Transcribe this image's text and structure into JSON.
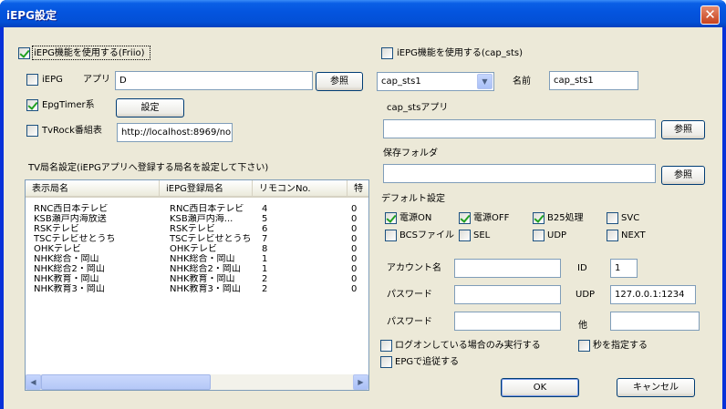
{
  "window": {
    "title": "iEPG設定",
    "close_glyph": "✕"
  },
  "left": {
    "use_friio": {
      "label": "iEPG機能を使用する(Friio)",
      "checked": true
    },
    "iepg": {
      "label": "iEPG",
      "checked": false
    },
    "app_label": "アプリ",
    "app_value": "D",
    "browse_button": "参照",
    "epgtimer": {
      "label": "EpgTimer系",
      "checked": true
    },
    "settings_button": "設定",
    "tvrock": {
      "label": "TvRock番組表",
      "checked": false
    },
    "tvrock_url": "http://localhost:8969/nol",
    "station_list_title": "TV局名設定(iEPGアプリへ登録する局名を設定して下さい)"
  },
  "station_table": {
    "columns": [
      "表示局名",
      "iEPG登録局名",
      "リモコンNo.",
      "特"
    ],
    "rows": [
      [
        "RNC西日本テレビ",
        "RNC西日本テレビ",
        "4",
        "0"
      ],
      [
        "KSB瀬戸内海放送",
        "KSB瀬戸内海...",
        "5",
        "0"
      ],
      [
        "RSKテレビ",
        "RSKテレビ",
        "6",
        "0"
      ],
      [
        "TSCテレビせとうち",
        "TSCテレビせとうち",
        "7",
        "0"
      ],
      [
        "OHKテレビ",
        "OHKテレビ",
        "8",
        "0"
      ],
      [
        "NHK総合・岡山",
        "NHK総合・岡山",
        "1",
        "0"
      ],
      [
        "NHK総合2・岡山",
        "NHK総合2・岡山",
        "1",
        "0"
      ],
      [
        "NHK教育・岡山",
        "NHK教育・岡山",
        "2",
        "0"
      ],
      [
        "NHK教育3・岡山",
        "NHK教育3・岡山",
        "2",
        "0"
      ]
    ],
    "scroll_left": "◀",
    "scroll_right": "▶"
  },
  "right": {
    "use_capsts": {
      "label": "iEPG機能を使用する(cap_sts)",
      "checked": false
    },
    "profile_select": "cap_sts1",
    "combo_arrow": "▼",
    "name_label": "名前",
    "name_value": "cap_sts1",
    "app_label": "cap_stsアプリ",
    "app_value": "",
    "app_browse": "参照",
    "folder_label": "保存フォルダ",
    "folder_value": "",
    "folder_browse": "参照",
    "defaults_label": "デフォルト設定",
    "opts": {
      "power_on": {
        "label": "電源ON",
        "checked": true
      },
      "power_off": {
        "label": "電源OFF",
        "checked": true
      },
      "b25": {
        "label": "B25処理",
        "checked": true
      },
      "svc": {
        "label": "SVC",
        "checked": false
      },
      "bcs": {
        "label": "BCSファイル",
        "checked": false
      },
      "sel": {
        "label": "SEL",
        "checked": false
      },
      "udp": {
        "label": "UDP",
        "checked": false
      },
      "next": {
        "label": "NEXT",
        "checked": false
      }
    },
    "account_label": "アカウント名",
    "account_value": "",
    "id_label": "ID",
    "id_value": "1",
    "password_label": "パスワード",
    "password_value": "",
    "udp_label": "UDP",
    "udp_value": "127.0.0.1:1234",
    "password2_label": "パスワード",
    "password2_value": "",
    "other_label": "他",
    "other_value": "",
    "logon_only": {
      "label": "ログオンしている場合のみ実行する",
      "checked": false
    },
    "seconds": {
      "label": "秒を指定する",
      "checked": false
    },
    "epg_follow": {
      "label": "EPGで追従する",
      "checked": false
    },
    "ok_button": "OK",
    "cancel_button": "キャンセル"
  }
}
